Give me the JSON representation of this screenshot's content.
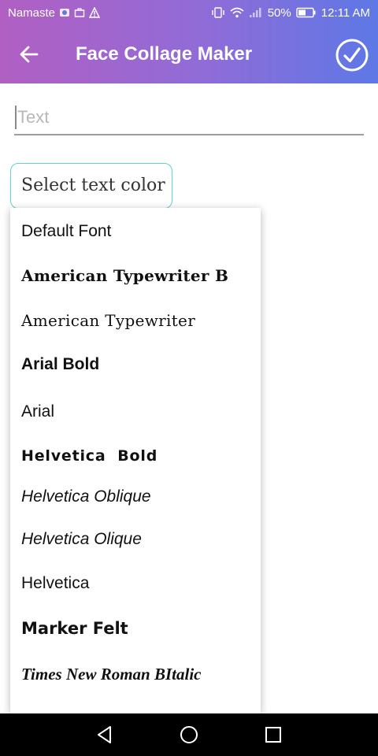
{
  "status_bar": {
    "carrier": "Namaste",
    "battery": "50%",
    "time": "12:11 AM"
  },
  "app_bar": {
    "title": "Face Collage Maker",
    "back_icon": "arrow-left-icon",
    "confirm_icon": "check-circle-icon"
  },
  "text_input": {
    "placeholder": "Text",
    "value": ""
  },
  "color_button": {
    "label": "Select text color",
    "border_color": "#5ed6d0"
  },
  "font_dropdown": {
    "options": [
      "Default Font",
      "American Typewriter B",
      "American Typewriter",
      "Arial Bold",
      "Arial",
      "Helvetica  Bold",
      "Helvetica Oblique",
      "Helvetica Olique",
      "Helvetica",
      "Marker Felt",
      "Times New Roman BItalic"
    ]
  },
  "nav_bar": {
    "icons": [
      "back-triangle-icon",
      "home-circle-icon",
      "recents-square-icon"
    ]
  },
  "colors": {
    "gradient_start": "#b15fc2",
    "gradient_end": "#5d78e6",
    "accent_teal": "#5ed6d0"
  }
}
